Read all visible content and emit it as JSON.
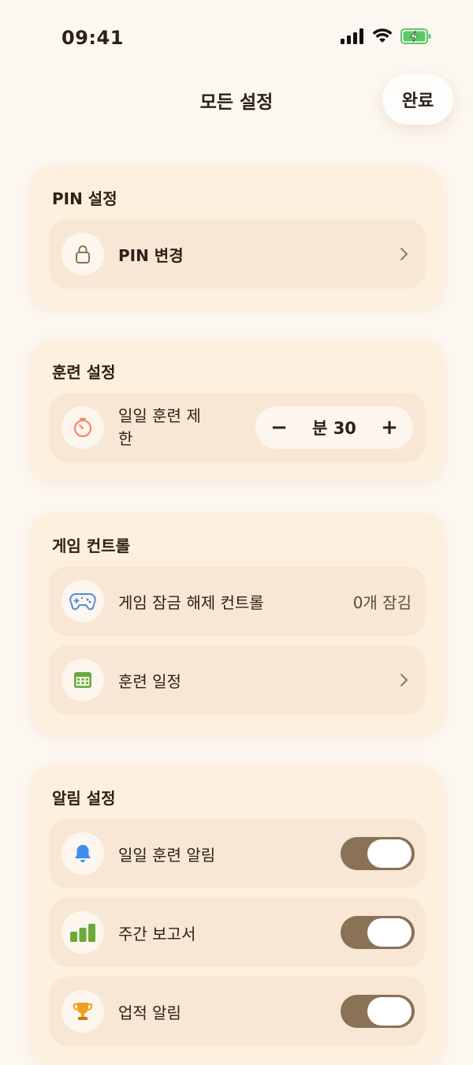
{
  "status_bar": {
    "time": "09:41",
    "icons": [
      "cellular-signal-icon",
      "wifi-icon",
      "battery-charging-icon"
    ],
    "battery_color": "#5cc86a"
  },
  "nav": {
    "title": "모든 설정",
    "done_label": "완료"
  },
  "sections": {
    "pin": {
      "title": "PIN 설정",
      "change_pin": {
        "label": "PIN 변경",
        "icon": "lock-icon"
      }
    },
    "training": {
      "title": "훈련 설정",
      "daily_limit": {
        "label": "일일 훈련 제한",
        "icon": "timer-icon",
        "decrement": "−",
        "increment": "+",
        "value": "분 30"
      }
    },
    "game": {
      "title": "게임 컨트롤",
      "unlock_control": {
        "label": "게임 잠금 해제 컨트롤",
        "value": "0개 잠김",
        "icon": "gamepad-icon"
      },
      "schedule": {
        "label": "훈련 일정",
        "icon": "calendar-icon"
      }
    },
    "notifications": {
      "title": "알림 설정",
      "daily_reminder": {
        "label": "일일 훈련 알림",
        "icon": "bell-icon",
        "enabled": true
      },
      "weekly_report": {
        "label": "주간 보고서",
        "icon": "bar-chart-icon",
        "enabled": true
      },
      "achievement": {
        "label": "업적 알림",
        "icon": "trophy-icon",
        "enabled": true
      }
    }
  },
  "colors": {
    "background": "#fdf7f1",
    "card": "#fdf0df",
    "row": "#f8e7d4",
    "toggle_on": "#8a7256",
    "timer_accent": "#f08a5d",
    "gamepad_accent": "#4a90d9",
    "calendar_accent": "#6aaa3a",
    "bell_accent": "#3d8ef0",
    "chart_accent": "#6aaa3a",
    "trophy_accent": "#f0a020"
  }
}
